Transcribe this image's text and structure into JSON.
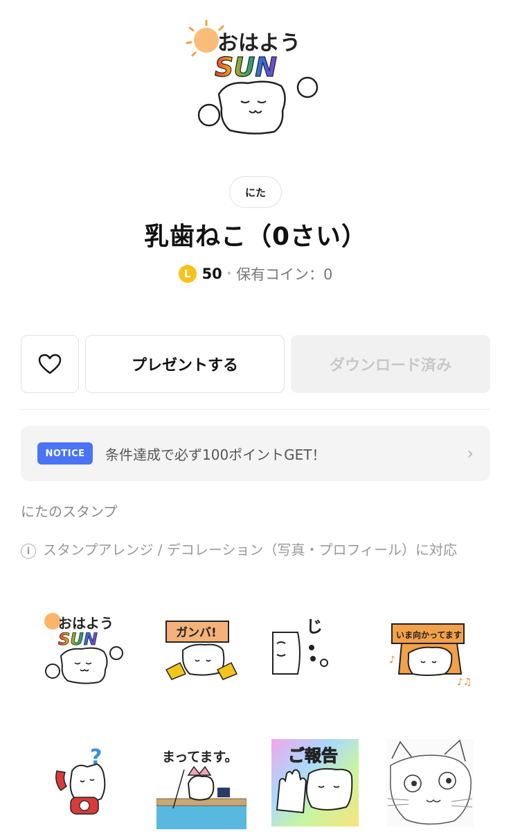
{
  "product": {
    "author": "にた",
    "title": "乳歯ねこ（0さい）",
    "coin_symbol": "L",
    "price": "50",
    "price_separator": "•",
    "owned_coins": "保有コイン：0"
  },
  "actions": {
    "like_icon": "heart-icon",
    "gift_label": "プレゼントする",
    "download_label": "ダウンロード済み"
  },
  "notice": {
    "badge": "NOTICE",
    "text": "条件達成で必ず100ポイントGET！",
    "chevron": "›"
  },
  "section": {
    "author_stickers": "にたのスタンプ",
    "info_glyph": "i",
    "arrange_note": "スタンプアレンジ / デコレーション（写真・プロフィール）に対応"
  },
  "stickers": {
    "hero_text_top": "おはよう",
    "hero_text_sun": "SUN",
    "s1_top": "おはよう",
    "s1_sun": "SUN",
    "s2_sign": "ガンバ!",
    "s4_sign": "いま向かってます",
    "s5_mark": "?",
    "s6_caption": "まってます。",
    "s7_caption": "ご報告"
  },
  "colors": {
    "coin": "#f7c21c",
    "notice_badge": "#4a74f5",
    "download_disabled_bg": "#f1f1f1",
    "download_disabled_text": "#c8c8c8"
  }
}
